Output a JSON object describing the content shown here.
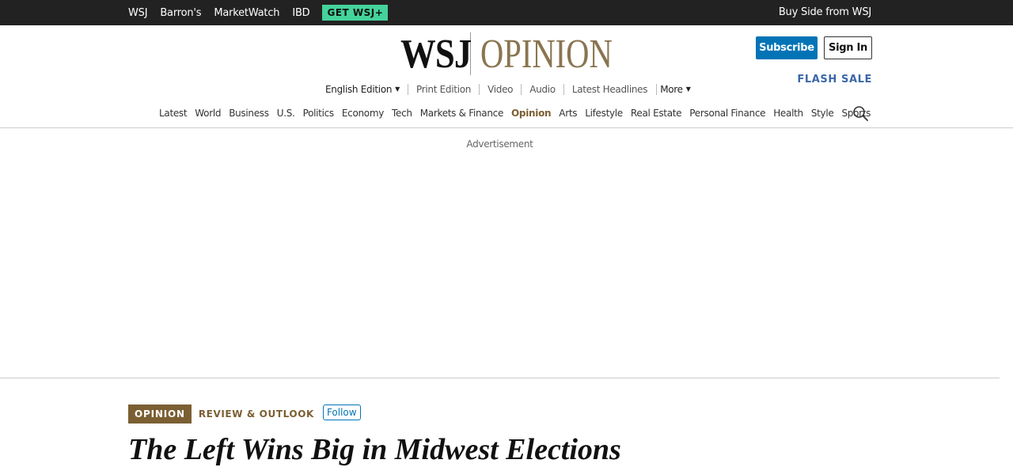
{
  "topbar": {
    "brands": [
      "WSJ",
      "Barron's",
      "MarketWatch",
      "IBD"
    ],
    "get_wsj_label": "GET WSJ+",
    "buyside_label": "Buy Side from WSJ"
  },
  "masthead": {
    "logo_wsj": "WSJ",
    "logo_section": "OPINION",
    "subscribe_label": "Subscribe",
    "signin_label": "Sign In",
    "flash_sale_label": "FLASH SALE"
  },
  "edition_bar": {
    "edition_label": "English Edition",
    "links": [
      "Print Edition",
      "Video",
      "Audio",
      "Latest Headlines"
    ],
    "more_label": "More"
  },
  "main_nav": {
    "items": [
      "Latest",
      "World",
      "Business",
      "U.S.",
      "Politics",
      "Economy",
      "Tech",
      "Markets & Finance",
      "Opinion",
      "Arts",
      "Lifestyle",
      "Real Estate",
      "Personal Finance",
      "Health",
      "Style",
      "Sports"
    ],
    "active": "Opinion"
  },
  "ad": {
    "label": "Advertisement"
  },
  "article": {
    "badge": "OPINION",
    "section": "REVIEW & OUTLOOK",
    "follow_label": "Follow",
    "headline": "The Left Wins Big in Midwest Elections"
  },
  "colors": {
    "topbar_bg": "#222222",
    "get_wsj_bg": "#44d39b",
    "subscribe_bg": "#0274b6",
    "opinion_accent": "#7b5f33",
    "logo_opinion": "#8a7550",
    "flash_sale": "#3a67a8"
  },
  "icons": {
    "search": "search-icon"
  }
}
